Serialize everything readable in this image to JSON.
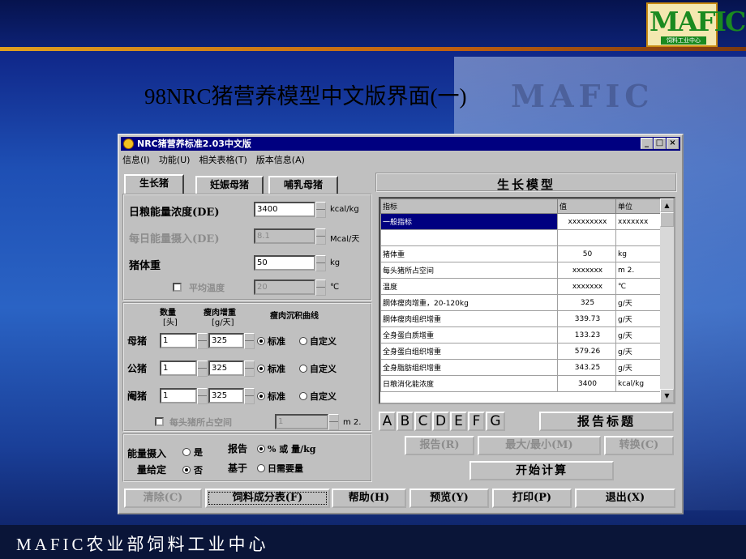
{
  "slide": {
    "title": "98NRC猪营养模型中文版界面(一)",
    "footer": "MAFIC农业部饲料工业中心",
    "logo": {
      "main": "MAFIC",
      "sub": "饲料工业中心"
    }
  },
  "window": {
    "title": "NRC猪营养标准2.03中文版",
    "minimize": "_",
    "maximize": "□",
    "close": "×",
    "menu": [
      "信息(I)",
      "功能(U)",
      "相关表格(T)",
      "版本信息(A)"
    ]
  },
  "tabs": [
    "生长猪",
    "妊娠母猪",
    "哺乳母猪"
  ],
  "inputs": {
    "de_label": "日粮能量浓度(DE)",
    "de_value": "3400",
    "de_unit": "kcal/kg",
    "daily_label": "每日能量摄入(DE)",
    "daily_value": "8.1",
    "daily_unit": "Mcal/天",
    "weight_label": "猪体重",
    "weight_value": "50",
    "weight_unit": "kg",
    "temp_label": "平均温度",
    "temp_value": "20",
    "temp_unit": "℃"
  },
  "herd": {
    "head_count": "数量",
    "head_unit": "[头]",
    "gain_head": "瘦肉增重",
    "gain_unit": "[g/天]",
    "curve_head": "瘦肉沉积曲线",
    "rows": [
      {
        "label": "母猪",
        "count": "1",
        "gain": "325",
        "std": "标准",
        "custom": "自定义"
      },
      {
        "label": "公猪",
        "count": "1",
        "gain": "325",
        "std": "标准",
        "custom": "自定义"
      },
      {
        "label": "阉猪",
        "count": "1",
        "gain": "325",
        "std": "标准",
        "custom": "自定义"
      }
    ],
    "space_label": "每头猪所占空间",
    "space_value": "1",
    "space_unit": "m 2."
  },
  "energy": {
    "label1": "能量摄入",
    "label2": "量给定",
    "yes": "是",
    "no": "否",
    "report_label1": "报告",
    "report_label2": "基于",
    "pct": "% 或 量/kg",
    "daily_req": "日需要量"
  },
  "model": {
    "title": "生长模型",
    "columns": [
      "指标",
      "值",
      "单位"
    ],
    "rows": [
      {
        "name": "一般指标",
        "value": "xxxxxxxxx",
        "unit": "xxxxxxx"
      },
      {
        "name": "",
        "value": "",
        "unit": ""
      },
      {
        "name": "猪体重",
        "value": "50",
        "unit": "kg"
      },
      {
        "name": "每头猪所占空间",
        "value": "xxxxxxx",
        "unit": "m 2."
      },
      {
        "name": "温度",
        "value": "xxxxxxx",
        "unit": "℃"
      },
      {
        "name": "胴体瘦肉增重，20-120kg",
        "value": "325",
        "unit": "g/天"
      },
      {
        "name": "胴体瘦肉组织增重",
        "value": "339.73",
        "unit": "g/天"
      },
      {
        "name": "全身蛋白质增重",
        "value": "133.23",
        "unit": "g/天"
      },
      {
        "name": "全身蛋白组织增重",
        "value": "579.26",
        "unit": "g/天"
      },
      {
        "name": "全身脂肪组织增重",
        "value": "343.25",
        "unit": "g/天"
      },
      {
        "name": "日粮消化能浓度",
        "value": "3400",
        "unit": "kcal/kg"
      }
    ]
  },
  "letters": [
    "A",
    "B",
    "C",
    "D",
    "E",
    "F",
    "G"
  ],
  "buttons": {
    "report_title": "报告标题",
    "report": "报告(R)",
    "maxmin": "最大/最小(M)",
    "convert": "转换(C)",
    "start": "开始计算",
    "clear": "清除(C)",
    "feed_table": "饲料成分表(F)",
    "help": "帮助(H)",
    "preview": "预览(Y)",
    "print": "打印(P)",
    "exit": "退出(X)"
  }
}
